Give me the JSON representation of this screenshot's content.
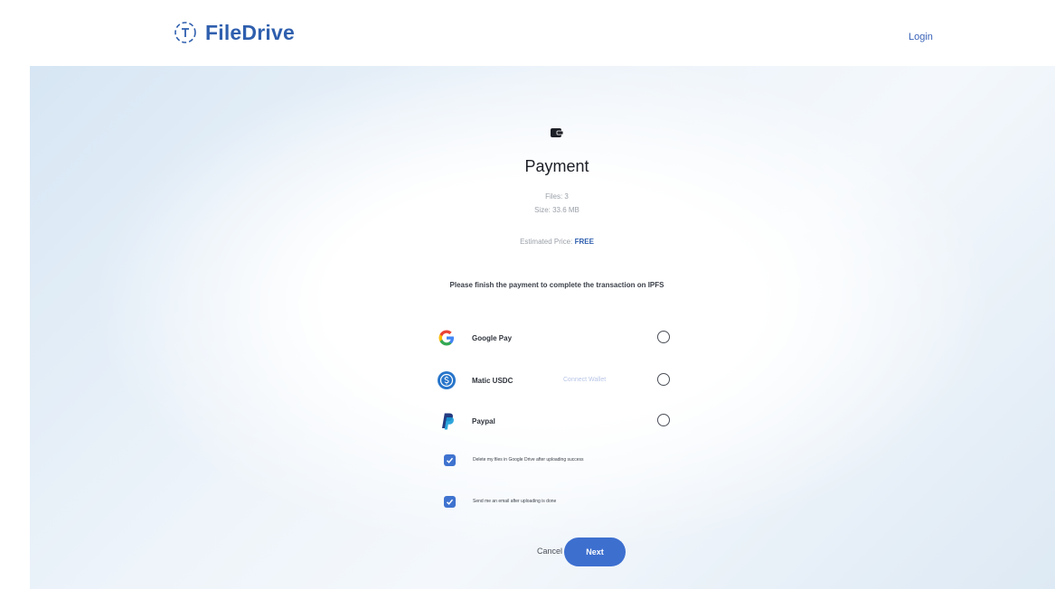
{
  "header": {
    "brand_name": "FileDrive",
    "login_label": "Login"
  },
  "payment": {
    "title": "Payment",
    "files": "Files: 3",
    "size": "Size: 33.6 MB",
    "price_label": "Estimated Price:",
    "price_value": "FREE",
    "instruction": "Please finish the payment to complete the transaction on IPFS"
  },
  "options": [
    {
      "label": "Google Pay",
      "icon": "google-icon",
      "selected": false
    },
    {
      "label": "Matic USDC",
      "hint": "Connect Wallet",
      "icon": "usdc-icon",
      "selected": false
    },
    {
      "label": "Paypal",
      "icon": "paypal-icon",
      "selected": false
    }
  ],
  "checkboxes": [
    {
      "label": "Delete my files in Google Drive after uploading success",
      "checked": true
    },
    {
      "label": "Send me an email after uploading is done",
      "checked": true
    }
  ],
  "actions": {
    "cancel_label": "Cancel",
    "next_label": "Next"
  },
  "colors": {
    "accent": "#3d6fcf",
    "brand": "#2f5fae"
  }
}
